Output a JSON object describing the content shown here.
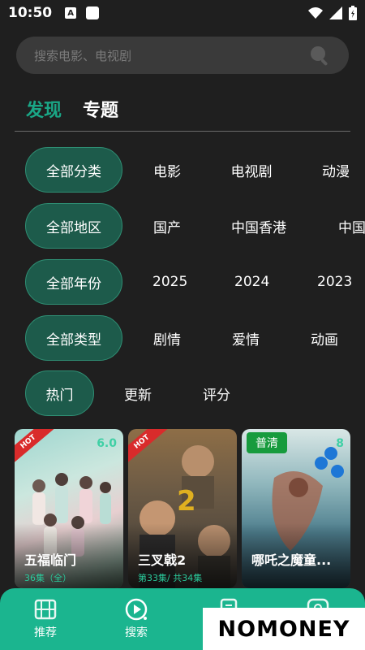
{
  "status": {
    "time": "10:50",
    "a_icon": "A"
  },
  "search": {
    "placeholder": "搜索电影、电视剧"
  },
  "top_tabs": [
    {
      "label": "发现",
      "active": true
    },
    {
      "label": "专题",
      "active": false
    }
  ],
  "filters": {
    "category": {
      "selected": "全部分类",
      "options": [
        "电影",
        "电视剧",
        "动漫"
      ]
    },
    "region": {
      "selected": "全部地区",
      "options": [
        "国产",
        "中国香港",
        "中国"
      ]
    },
    "year": {
      "selected": "全部年份",
      "options": [
        "2025",
        "2024",
        "2023"
      ]
    },
    "genre": {
      "selected": "全部类型",
      "options": [
        "剧情",
        "爱情",
        "动画"
      ]
    },
    "sort": {
      "selected": "热门",
      "options": [
        "更新",
        "评分"
      ]
    }
  },
  "cards": [
    {
      "title": "五福临门",
      "episodes": "36集（全）",
      "score": "6.0",
      "badge": "HOT"
    },
    {
      "title": "三叉戟2",
      "episodes": "第33集/ 共34集",
      "score": "",
      "badge": "HOT"
    },
    {
      "title": "哪吒之魔童...",
      "episodes": "",
      "score": "8",
      "badge": "普清"
    }
  ],
  "bottom_nav": [
    {
      "label": "推荐",
      "icon": "film-icon"
    },
    {
      "label": "搜索",
      "icon": "play-icon"
    },
    {
      "label": "",
      "icon": "list-icon"
    },
    {
      "label": "",
      "icon": "profile-icon"
    }
  ],
  "watermark": {
    "text": "NOMONEY"
  },
  "colors": {
    "accent": "#1aa686",
    "pill_bg": "#1d5b4b",
    "nav_bg": "#1bb58f",
    "hot": "#d92b2b",
    "hd": "#179b3d"
  }
}
